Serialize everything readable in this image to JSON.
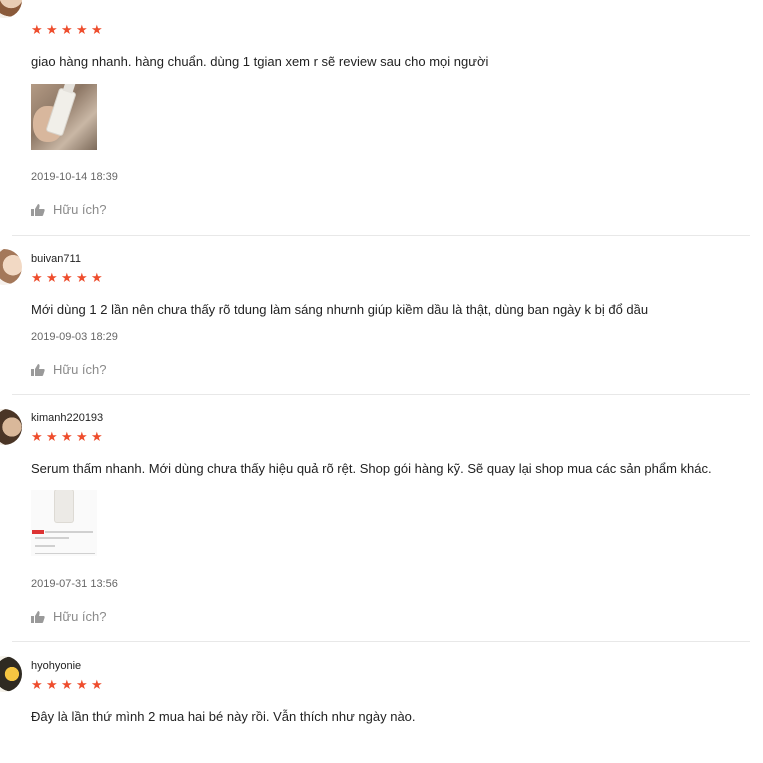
{
  "accent_color": "#ee4d2d",
  "reviews": [
    {
      "username": "",
      "rating": 5,
      "comment": "giao hàng nhanh. hàng chuẩn. dùng 1 tgian xem r sẽ review sau cho mọi người",
      "date": "2019-10-14 18:39",
      "helpful_label": "Hữu ích?"
    },
    {
      "username": "buivan711",
      "rating": 5,
      "comment": "Mới dùng 1 2 lần nên chưa thấy rõ tdung làm sáng nhưnh giúp kiềm dầu là thật, dùng ban ngày k bị đổ dầu",
      "date": "2019-09-03 18:29",
      "helpful_label": "Hữu ích?"
    },
    {
      "username": "kimanh220193",
      "rating": 5,
      "comment": "Serum thấm nhanh. Mới dùng chưa thấy hiệu quả rõ rệt. Shop gói hàng kỹ. Sẽ quay lại shop mua các sản phẩm khác.",
      "date": "2019-07-31 13:56",
      "helpful_label": "Hữu ích?"
    },
    {
      "username": "hyohyonie",
      "rating": 5,
      "comment": "Đây là lần thứ mình 2 mua hai bé này rồi. Vẫn thích như ngày nào."
    }
  ],
  "icons": {
    "star": "star-icon",
    "thumbs_up": "thumbs-up-icon"
  }
}
